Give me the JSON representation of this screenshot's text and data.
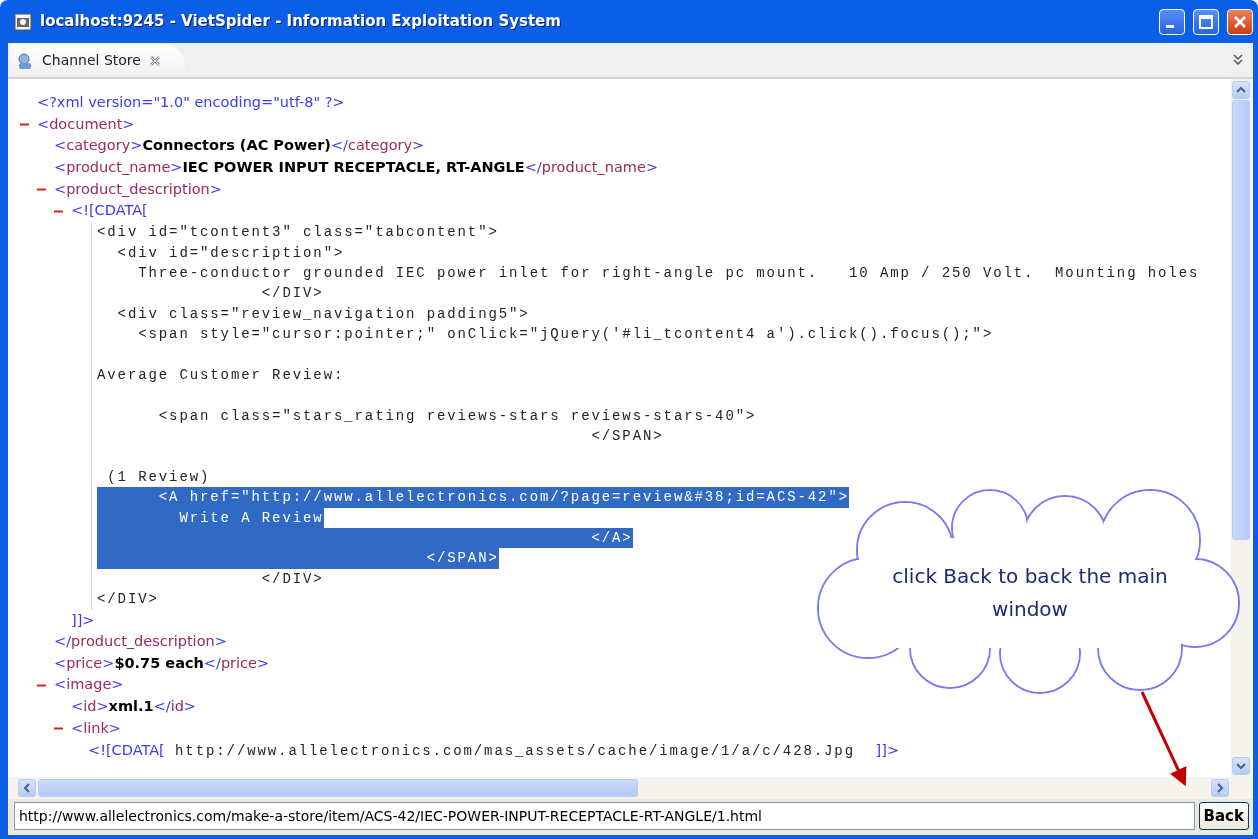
{
  "window": {
    "title": "localhost:9245 - VietSpider - Information Exploitation System"
  },
  "tabs": [
    {
      "label": "Channel Store",
      "selected": true
    }
  ],
  "xml_view": {
    "nodes": [
      {
        "kind": "pi",
        "text": "<?xml version=\"1.0\" encoding=\"utf-8\" ?>"
      },
      {
        "kind": "element",
        "open": "<document>",
        "expanded": true,
        "children": [
          {
            "kind": "leaf",
            "open": "<category>",
            "value": "Connectors (AC Power)",
            "close": "</category>"
          },
          {
            "kind": "leaf",
            "open": "<product_name>",
            "value": "IEC POWER INPUT RECEPTACLE, RT-ANGLE",
            "close": "</product_name>"
          },
          {
            "kind": "element",
            "open": "<product_description>",
            "expanded": true,
            "close": "</product_description>",
            "children": [
              {
                "kind": "cdata",
                "open": "<![CDATA[",
                "expanded": true,
                "close": "]]>",
                "lines": [
                  {
                    "kind": "code",
                    "text": "<div id=\"tcontent3\" class=\"tabcontent\">",
                    "selected": false
                  },
                  {
                    "kind": "code",
                    "text": "  <div id=\"description\">",
                    "selected": false
                  },
                  {
                    "kind": "code",
                    "text": "    Three-conductor grounded IEC power inlet for right-angle pc mount.   10 Amp / 250 Volt.  Mounting holes",
                    "selected": false
                  },
                  {
                    "kind": "code",
                    "text": "                </DIV>",
                    "selected": false
                  },
                  {
                    "kind": "code",
                    "text": "  <div class=\"review_navigation padding5\">",
                    "selected": false
                  },
                  {
                    "kind": "code",
                    "text": "    <span style=\"cursor:pointer;\" onClick=\"jQuery('#li_tcontent4 a').click().focus();\">",
                    "selected": false
                  },
                  {
                    "kind": "blank"
                  },
                  {
                    "kind": "code",
                    "text": "Average Customer Review:",
                    "selected": false
                  },
                  {
                    "kind": "blank"
                  },
                  {
                    "kind": "code",
                    "text": "      <span class=\"stars_rating reviews-stars reviews-stars-40\">",
                    "selected": false
                  },
                  {
                    "kind": "code",
                    "text": "                                                </SPAN>",
                    "selected": false
                  },
                  {
                    "kind": "blank"
                  },
                  {
                    "kind": "code",
                    "text": " (1 Review)",
                    "selected": false
                  },
                  {
                    "kind": "code",
                    "text": "      <A href=\"http://www.allelectronics.com/?page=review&#38;id=ACS-42\">",
                    "selected": true
                  },
                  {
                    "kind": "code",
                    "text": "        Write A Review",
                    "selected": true
                  },
                  {
                    "kind": "code",
                    "text": "                                                </A>",
                    "selected": true
                  },
                  {
                    "kind": "code",
                    "text": "                                </SPAN>",
                    "selected": true
                  },
                  {
                    "kind": "code",
                    "text": "                </DIV>",
                    "selected": false
                  },
                  {
                    "kind": "code",
                    "text": "</DIV>",
                    "selected": false
                  }
                ]
              }
            ]
          },
          {
            "kind": "leaf",
            "open": "<price>",
            "value": "$0.75 each",
            "close": "</price>"
          },
          {
            "kind": "element",
            "open": "<image>",
            "expanded": true,
            "children": [
              {
                "kind": "leaf",
                "open": "<id>",
                "value": "xml.1",
                "close": "</id>"
              },
              {
                "kind": "element",
                "open": "<link>",
                "expanded": true,
                "children": [
                  {
                    "kind": "cdata_inline",
                    "open": "<![CDATA[",
                    "value": " http://www.allelectronics.com/mas_assets/cache/image/1/a/c/428.Jpg  ",
                    "close": "]]>"
                  }
                ]
              }
            ]
          }
        ]
      }
    ]
  },
  "address_field": {
    "value": "http://www.allelectronics.com/make-a-store/item/ACS-42/IEC-POWER-INPUT-RECEPTACLE-RT-ANGLE/1.html"
  },
  "back_button": {
    "label": "Back"
  },
  "callout": {
    "text": "click Back to back the main window"
  }
}
